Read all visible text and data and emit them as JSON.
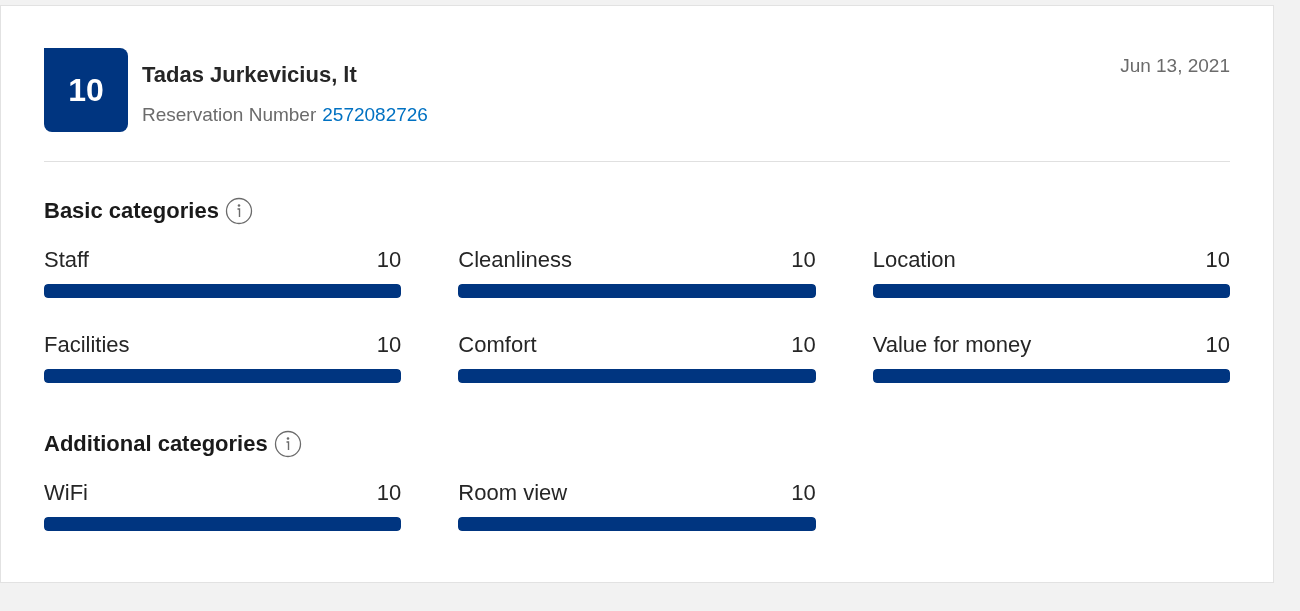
{
  "review": {
    "score": "10",
    "name": "Tadas Jurkevicius, lt",
    "reservation_label": "Reservation Number",
    "reservation_number": "2572082726",
    "date": "Jun 13, 2021"
  },
  "sections": [
    {
      "title": "Basic categories",
      "items": [
        {
          "label": "Staff",
          "value": "10",
          "level": 1
        },
        {
          "label": "Cleanliness",
          "value": "10",
          "level": 1
        },
        {
          "label": "Location",
          "value": "10",
          "level": 1
        },
        {
          "label": "Facilities",
          "value": "10",
          "level": 1
        },
        {
          "label": "Comfort",
          "value": "10",
          "level": 1
        },
        {
          "label": "Value for money",
          "value": "10",
          "level": 1
        }
      ]
    },
    {
      "title": "Additional categories",
      "items": [
        {
          "label": "WiFi",
          "value": "10",
          "level": 1
        },
        {
          "label": "Room view",
          "value": "10",
          "level": 1
        }
      ]
    }
  ]
}
